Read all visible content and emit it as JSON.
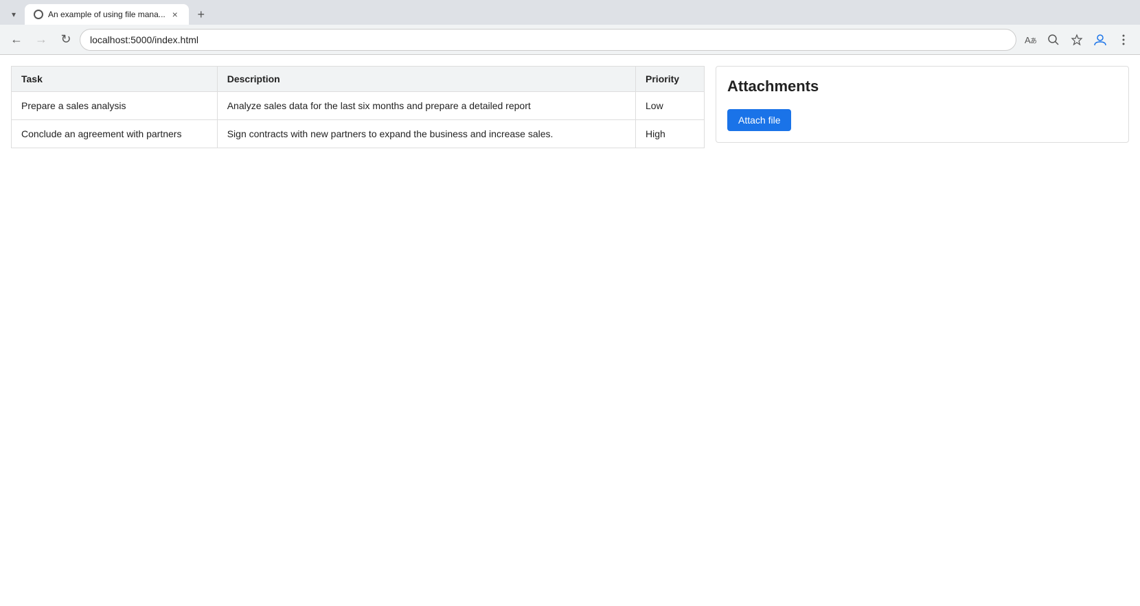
{
  "browser": {
    "tab_label": "An example of using file mana...",
    "tab_favicon_alt": "page-favicon",
    "new_tab_symbol": "+",
    "tab_close_symbol": "×",
    "tab_dropdown_symbol": "▾"
  },
  "navbar": {
    "back_label": "←",
    "forward_label": "→",
    "refresh_label": "↻",
    "address": "localhost:5000/index.html",
    "translate_label": "⊞",
    "search_label": "🔍",
    "favorite_label": "☆",
    "profile_label": "👤",
    "menu_label": "⋮"
  },
  "table": {
    "headers": [
      "Task",
      "Description",
      "Priority"
    ],
    "rows": [
      {
        "task": "Prepare a sales analysis",
        "description": "Analyze sales data for the last six months and prepare a detailed report",
        "priority": "Low"
      },
      {
        "task": "Conclude an agreement with partners",
        "description": "Sign contracts with new partners to expand the business and increase sales.",
        "priority": "High"
      }
    ]
  },
  "attachments": {
    "title": "Attachments",
    "attach_button_label": "Attach file"
  }
}
